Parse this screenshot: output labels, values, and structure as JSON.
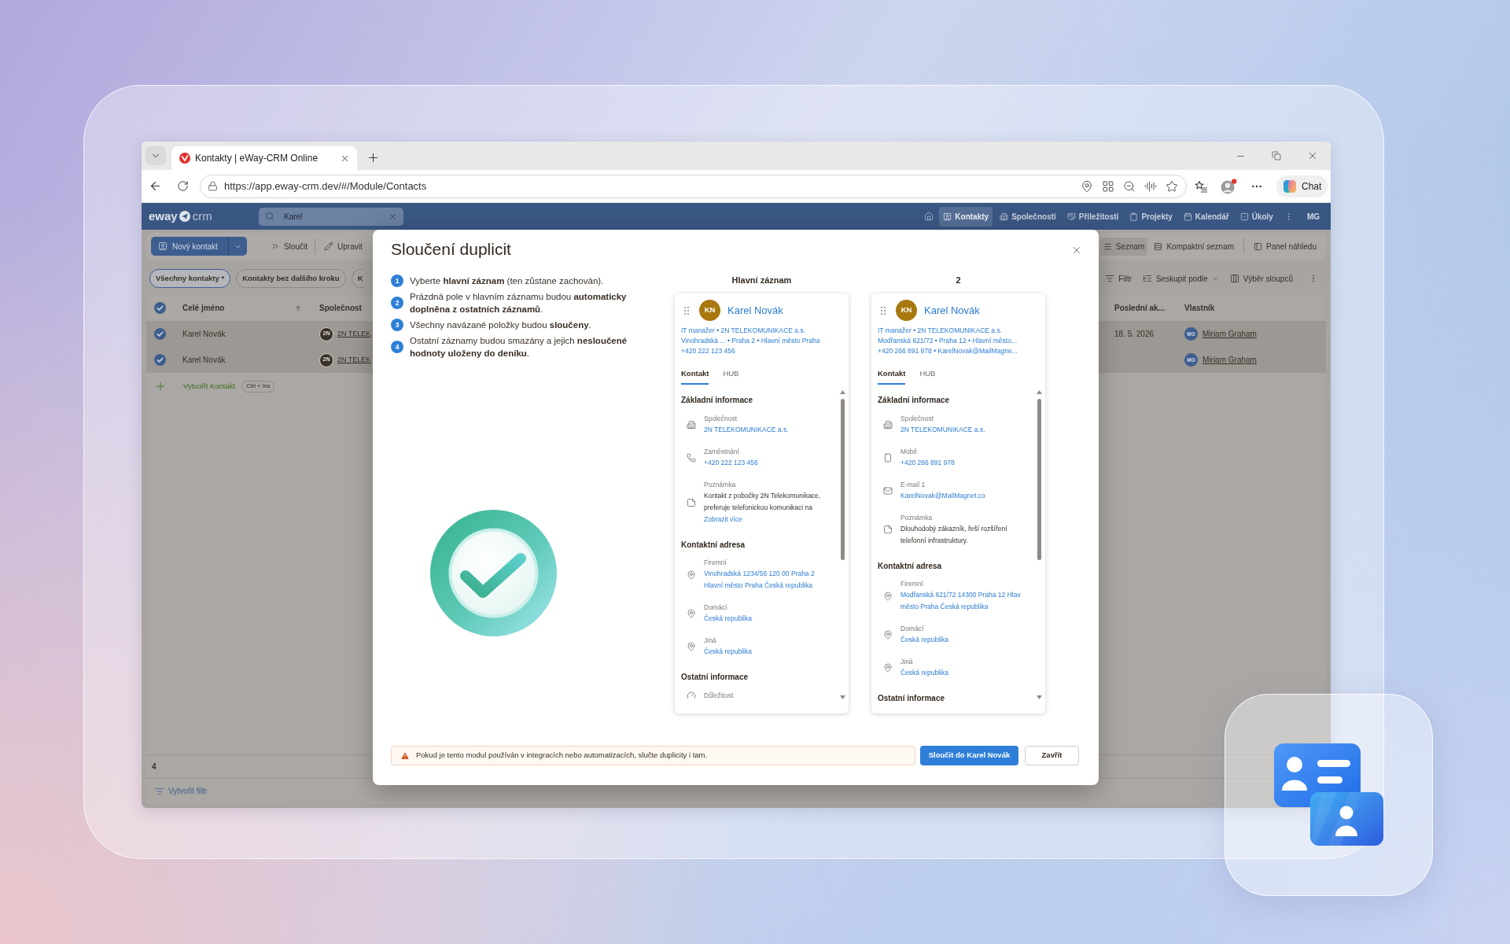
{
  "browser": {
    "tab_title": "Kontakty | eWay-CRM Online",
    "url": "https://app.eway-crm.dev/#/Module/Contacts",
    "chat_label": "Chat"
  },
  "app": {
    "logo": {
      "word": "eway",
      "suffix": "crm"
    },
    "search": {
      "value": "Karel"
    },
    "nav": [
      {
        "kind": "contacts",
        "label": "Kontakty",
        "selected": true
      },
      {
        "kind": "companies",
        "label": "Společnosti",
        "selected": false
      },
      {
        "kind": "deals",
        "label": "Příležitosti",
        "selected": false
      },
      {
        "kind": "projects",
        "label": "Projekty",
        "selected": false
      },
      {
        "kind": "calendar",
        "label": "Kalendář",
        "selected": false
      },
      {
        "kind": "tasks",
        "label": "Úkoly",
        "selected": false
      }
    ],
    "user_initials": "MG",
    "commands": [
      {
        "kind": "new",
        "label": "Nový kontakt"
      },
      {
        "kind": "merge",
        "label": "Sloučit"
      },
      {
        "kind": "edit",
        "label": "Upravit"
      }
    ],
    "views": [
      {
        "kind": "list",
        "label": "Seznam",
        "selected": true
      },
      {
        "kind": "compact",
        "label": "Kompaktní seznam",
        "selected": false
      },
      {
        "kind": "preview",
        "label": "Panel náhledu",
        "selected": false
      }
    ],
    "filters": [
      {
        "label": "Všechny kontakty *",
        "selected": true
      },
      {
        "label": "Kontakty bez dalšího kroku",
        "selected": false
      },
      {
        "label": "K",
        "selected": false
      }
    ],
    "tools": [
      {
        "kind": "filter",
        "label": "Filtr"
      },
      {
        "kind": "group",
        "label": "Seskupit podle"
      },
      {
        "kind": "columns",
        "label": "Výběr sloupců"
      }
    ],
    "table": {
      "all_checked": true,
      "columns": [
        {
          "label": "Celé jméno",
          "sorted": true
        },
        {
          "label": "Společnost"
        },
        {
          "label": "Poslední ak..."
        },
        {
          "label": "Vlastník"
        }
      ],
      "rows": [
        {
          "selected": true,
          "name": "Karel Novák",
          "company_logo": "2N",
          "company": "2N TELEK",
          "last_activity": "18. 5. 2026",
          "owner_initials": "MG",
          "owner": "Miriam Graham"
        },
        {
          "selected": true,
          "name": "Karel Novák",
          "company_logo": "2N",
          "company": "2N TELEK",
          "owner_initials": "MG",
          "owner": "Miriam Graham"
        }
      ],
      "create": {
        "label": "Vytvořit Kontakt",
        "shortcut": "Ctrl + Ins"
      },
      "count": "4"
    },
    "create_filter": "Vytvořit filtr"
  },
  "dialog": {
    "title": "Sloučení duplicit",
    "steps": [
      {
        "number": "1",
        "text": "Vyberte **hlavní záznam** (ten zůstane zachován)."
      },
      {
        "number": "2",
        "text": "Prázdná pole v hlavním záznamu budou **automaticky doplněna z ostatních záznamů**."
      },
      {
        "number": "3",
        "text": "Všechny navázané položky budou **sloučeny**."
      },
      {
        "number": "4",
        "text": "Ostatní záznamy budou smazány a jejich **nesloučené hodnoty uloženy do deníku**."
      }
    ],
    "records": [
      {
        "heading": "Hlavní záznam",
        "initials": "KN",
        "name": "Karel Novák",
        "summary": [
          "IT manažer • 2N TELEKOMUNIKACE a.s.",
          "Vinohradská ... • Praha 2 • Hlavní město Praha",
          "+420 222 123 456"
        ],
        "tabs": [
          {
            "label": "Kontakt",
            "selected": true
          },
          {
            "label": "HUB",
            "selected": false
          }
        ],
        "sections": [
          {
            "title": "Základní informace",
            "fields": [
              {
                "kind": "company",
                "label": "Společnost",
                "lines": [
                  "2N TELEKOMUNIKACE a.s."
                ]
              },
              {
                "kind": "phone",
                "label": "Zaměstnání",
                "lines": [
                  "+420 222 123 456"
                ]
              },
              {
                "kind": "note",
                "label": "Poznámka",
                "lines": [
                  "Kontakt z pobočky 2N Telekomunikace,",
                  "preferuje telefonickou komunikaci na"
                ],
                "link": "Zobrazit více"
              }
            ]
          },
          {
            "title": "Kontaktní adresa",
            "fields": [
              {
                "kind": "address",
                "label": "Firemní",
                "lines": [
                  "Vinohradská 1234/56 120 00 Praha 2",
                  "Hlavní město Praha Česká republika"
                ]
              },
              {
                "kind": "address",
                "label": "Domácí",
                "lines": [
                  "Česká republika"
                ]
              },
              {
                "kind": "address",
                "label": "Jiná",
                "lines": [
                  "Česká republika"
                ]
              }
            ]
          },
          {
            "title": "Ostatní informace",
            "fields": [
              {
                "kind": "priority",
                "label": "Důležitost"
              }
            ]
          }
        ]
      },
      {
        "heading": "2",
        "initials": "KN",
        "name": "Karel Novák",
        "summary": [
          "IT manažer • 2N TELEKOMUNIKACE a.s.",
          "Modřanská 621/72 • Praha 12 • Hlavní město...",
          "+420 266 891 978 • KarelNovak@MailMagne..."
        ],
        "tabs": [
          {
            "label": "Kontakt",
            "selected": true
          },
          {
            "label": "HUB",
            "selected": false
          }
        ],
        "sections": [
          {
            "title": "Základní informace",
            "fields": [
              {
                "kind": "company",
                "label": "Společnost",
                "lines": [
                  "2N TELEKOMUNIKACE a.s."
                ]
              },
              {
                "kind": "mobile",
                "label": "Mobil",
                "lines": [
                  "+420 266 891 978"
                ]
              },
              {
                "kind": "email",
                "label": "E-mail 1",
                "lines": [
                  "KarelNovak@MailMagnet.co"
                ]
              },
              {
                "kind": "note",
                "label": "Poznámka",
                "lines": [
                  "Dlouhodobý zákazník, řeší rozšíření",
                  "telefonní infrastruktury."
                ]
              }
            ]
          },
          {
            "title": "Kontaktní adresa",
            "fields": [
              {
                "kind": "address",
                "label": "Firemní",
                "lines": [
                  "Modřanská 621/72 14300 Praha 12 Hlav",
                  "město Praha Česká republika"
                ]
              },
              {
                "kind": "address",
                "label": "Domácí",
                "lines": [
                  "Česká republika"
                ]
              },
              {
                "kind": "address",
                "label": "Jiná",
                "lines": [
                  "Česká republika"
                ]
              }
            ]
          },
          {
            "title": "Ostatní informace"
          }
        ]
      }
    ],
    "warning": "Pokud je tento modul používán v integracích nebo automatizacích, slučte duplicity i tam.",
    "buttons": [
      {
        "kind": "primary",
        "label": "Sloučit do Karel Novák"
      },
      {
        "kind": "secondary",
        "label": "Zavřít"
      }
    ]
  }
}
